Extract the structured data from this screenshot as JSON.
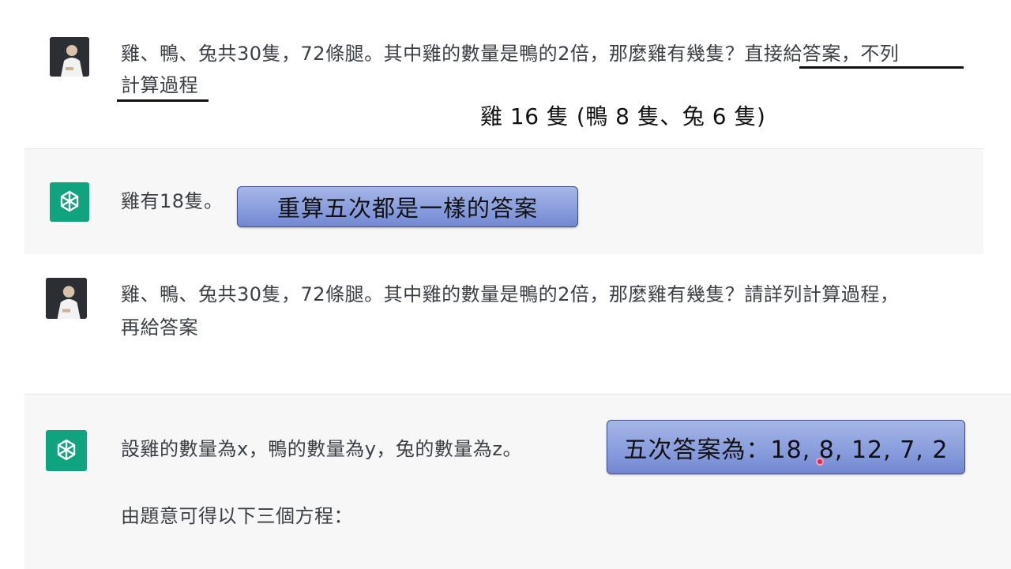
{
  "conversation": {
    "turn1": {
      "user_question": "雞、鴨、兔共30隻，72條腿。其中雞的數量是鴨的2倍，那麼雞有幾隻？直接給答案，不列計算過程"
    },
    "turn1_parts": {
      "line1_plain": "雞、鴨、兔共30隻，72條腿。其中雞的數量是鴨的2倍，那麼雞有幾隻？",
      "line1_underlined": "直接給答案，不列",
      "line2_underlined": "計算過程"
    },
    "turn2": {
      "ai_answer": "雞有18隻。"
    },
    "turn3": {
      "line1": "雞、鴨、兔共30隻，72條腿。其中雞的數量是鴨的2倍，那麼雞有幾隻？請詳列計算過程，",
      "line2": "再給答案"
    },
    "turn4": {
      "line1": "設雞的數量為x，鴨的數量為y，兔的數量為z。",
      "line2": "由題意可得以下三個方程："
    }
  },
  "annotations": {
    "correct_answer": "雞 16 隻 (鴨 8 隻、兔 6 隻)",
    "repeat_note": "重算五次都是一樣的答案",
    "five_answers": "五次答案為：18, 8, 12, 7, 2"
  },
  "icons": {
    "user_avatar": "user-photo-avatar",
    "assistant_avatar": "openai-logo-icon"
  },
  "colors": {
    "assistant_brand": "#10a37f",
    "ai_background": "#f7f7f8",
    "callout_fill": "#8a9ede",
    "pointer": "#e0245e"
  }
}
